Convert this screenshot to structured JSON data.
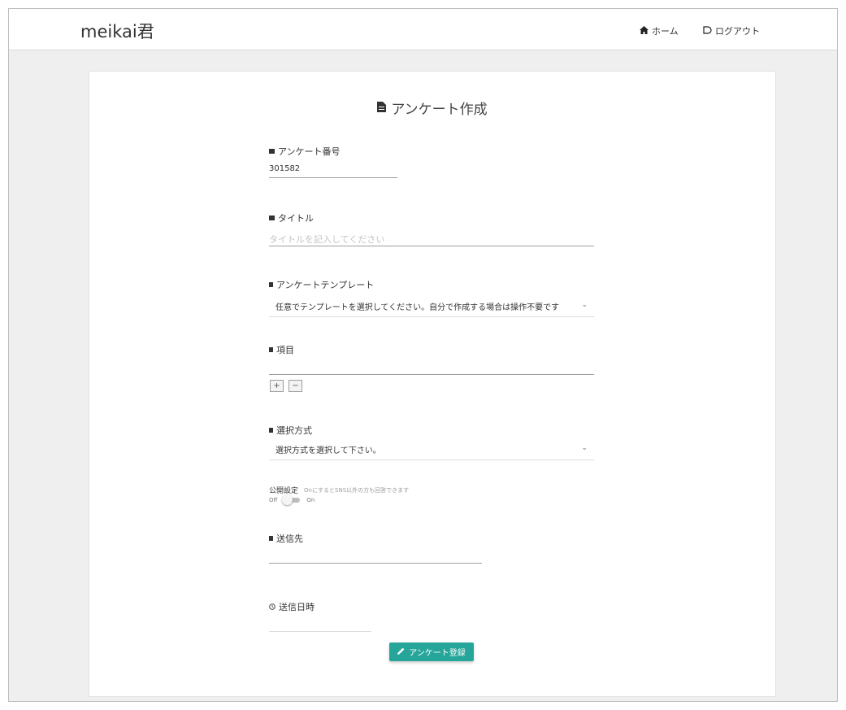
{
  "navbar": {
    "brand": "meikai君",
    "home_label": "ホーム",
    "logout_label": "ログアウト"
  },
  "page": {
    "title": "アンケート作成"
  },
  "form": {
    "survey_number": {
      "label": "アンケート番号",
      "value": "301582"
    },
    "title": {
      "label": "タイトル",
      "placeholder": "タイトルを記入してください"
    },
    "template": {
      "label": "アンケートテンプレート",
      "selected": "任意でテンプレートを選択してください。自分で作成する場合は操作不要です"
    },
    "items": {
      "label": "項目",
      "add_label": "+",
      "remove_label": "−"
    },
    "selection_method": {
      "label": "選択方式",
      "selected": "選択方式を選択して下さい。"
    },
    "public_setting": {
      "label": "公開設定",
      "hint": "OnにするとSNS以外の方も回答できます",
      "off_label": "Off",
      "on_label": "On",
      "state": "off"
    },
    "recipients": {
      "label": "送信先"
    },
    "send_datetime": {
      "label": "送信日時"
    },
    "submit_label": "アンケート登録"
  },
  "colors": {
    "accent": "#26a69a",
    "background": "#efefef"
  }
}
